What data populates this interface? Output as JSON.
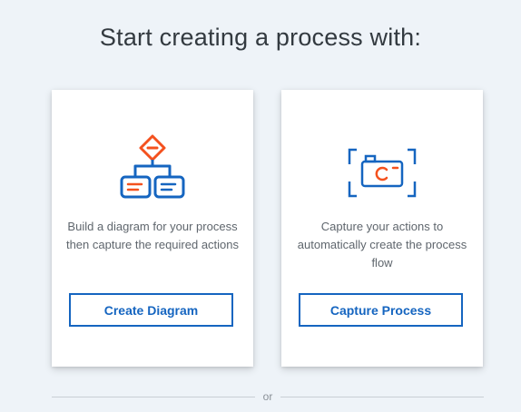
{
  "heading": "Start creating a process with:",
  "cards": [
    {
      "icon": "flowchart-diagram-icon",
      "description": "Build a diagram for your process then capture the required actions",
      "button_label": "Create Diagram"
    },
    {
      "icon": "camera-capture-icon",
      "description": "Capture your actions to automatically create the process flow",
      "button_label": "Capture Process"
    }
  ],
  "divider_label": "or",
  "colors": {
    "background": "#eef3f8",
    "primary_blue": "#1565c0",
    "accent_orange": "#f4511e",
    "text_dark": "#333a40",
    "text_muted": "#5f666d"
  }
}
